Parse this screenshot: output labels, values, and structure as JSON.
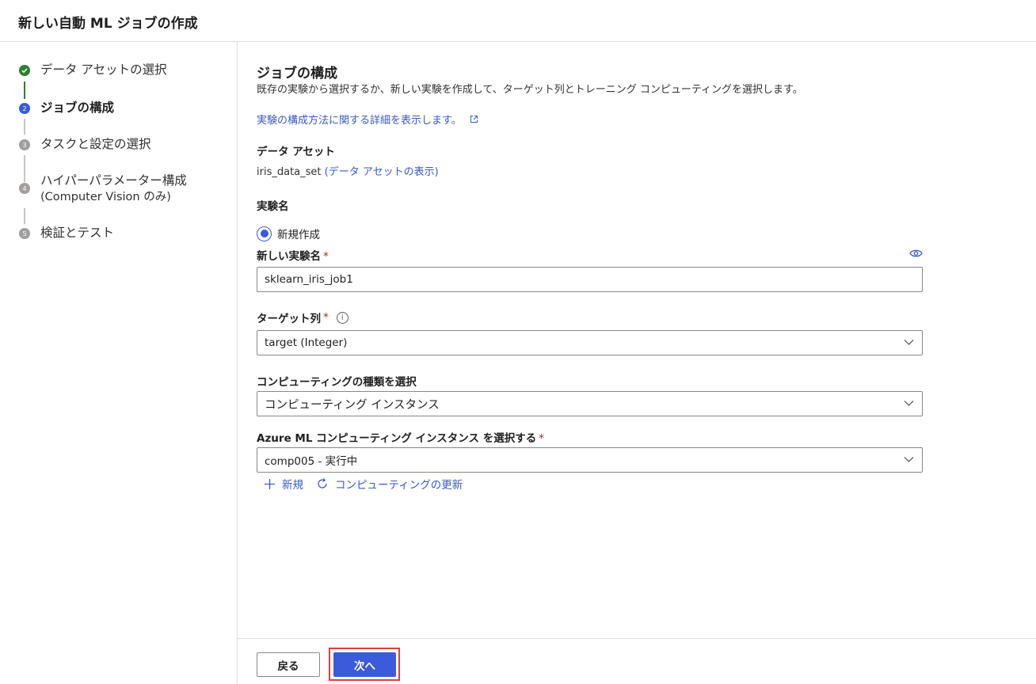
{
  "header": {
    "title": "新しい自動 ML ジョブの作成"
  },
  "steps": [
    {
      "number": "✓",
      "label": "データ アセットの選択",
      "state": "done"
    },
    {
      "number": "2",
      "label": "ジョブの構成",
      "state": "current"
    },
    {
      "number": "3",
      "label": "タスクと設定の選択",
      "state": "pending"
    },
    {
      "number": "4",
      "label": "ハイパーパラメーター構成",
      "label2": "(Computer Vision のみ)",
      "state": "pending"
    },
    {
      "number": "5",
      "label": "検証とテスト",
      "state": "pending"
    }
  ],
  "main": {
    "title": "ジョブの構成",
    "description": "既存の実験から選択するか、新しい実験を作成して、ターゲット列とトレーニング コンピューティングを選択します。",
    "learn_link": "実験の構成方法に関する詳細を表示します。",
    "data_asset": {
      "label": "データ アセット",
      "name": "iris_data_set",
      "view_link": "(データ アセットの表示)"
    },
    "experiment": {
      "label": "実験名",
      "radio_new": "新規作成",
      "new_name_label": "新しい実験名",
      "new_name_value": "sklearn_iris_job1"
    },
    "target_column": {
      "label": "ターゲット列",
      "value": "target (Integer)"
    },
    "compute_type": {
      "label": "コンピューティングの種類を選択",
      "value": "コンピューティング インスタンス"
    },
    "compute_instance": {
      "label": "Azure ML コンピューティング インスタンス を選択する",
      "value": "comp005 - 実行中"
    },
    "required_marker": "*",
    "actions": {
      "new_label": "新規",
      "refresh_label": "コンピューティングの更新"
    }
  },
  "footer": {
    "back_label": "戻る",
    "next_label": "次へ"
  },
  "colors": {
    "accent": "#3b5bdb",
    "link": "#3a59c9",
    "done": "#2e7d32",
    "highlight": "#e03e3e"
  }
}
